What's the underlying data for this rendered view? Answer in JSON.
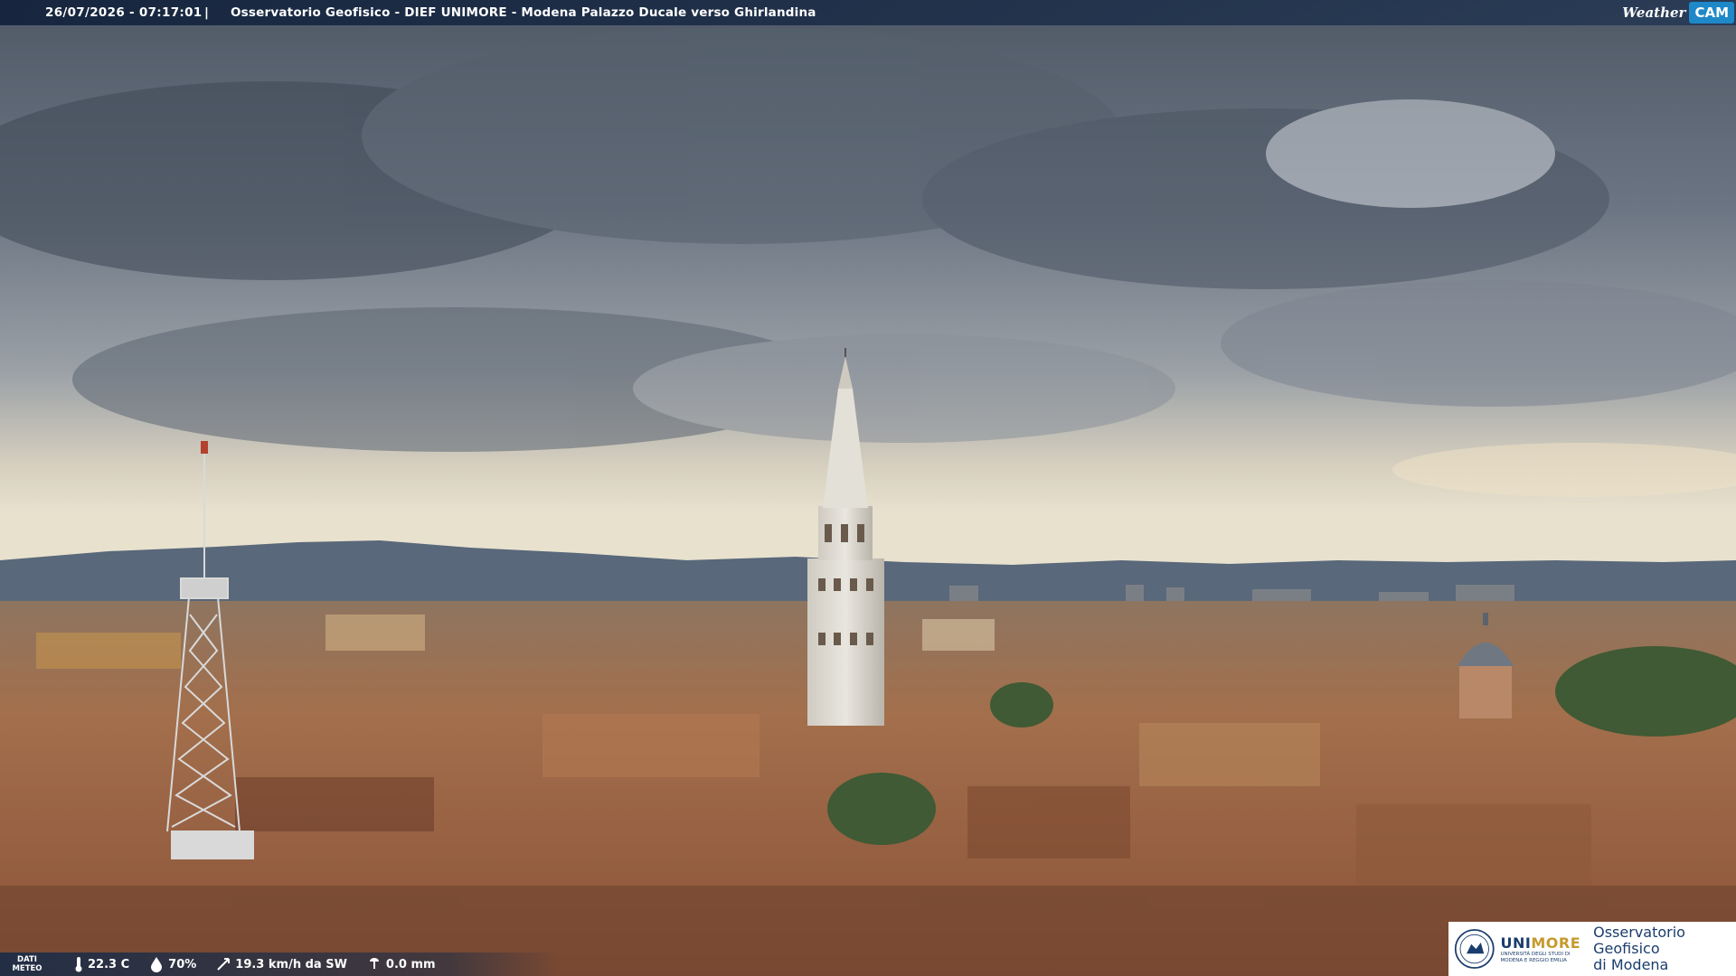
{
  "overlay": {
    "timestamp": "26/07/2026 - 07:17:01",
    "separator": "|",
    "title": "Osservatorio Geofisico - DIEF UNIMORE - Modena Palazzo Ducale verso Ghirlandina",
    "brand_weather": "Weather",
    "brand_cam": "CAM"
  },
  "meteo": {
    "label_line1": "DATI",
    "label_line2": "METEO",
    "temperature": "22.3 C",
    "humidity": "70%",
    "wind": "19.3 km/h da SW",
    "rain": "0.0 mm",
    "icons": [
      "thermometer-icon",
      "humidity-drop-icon",
      "wind-icon",
      "rain-gauge-icon"
    ]
  },
  "logo": {
    "university_name_a": "UNI",
    "university_name_b": "MORE",
    "university_sub1": "UNIVERSITÀ DEGLI STUDI DI",
    "university_sub2": "MODENA E REGGIO EMILIA",
    "observatory_line1": "Osservatorio Geofisico",
    "observatory_line2": "di Modena"
  },
  "colors": {
    "sky_top": "#56606e",
    "sky_horizon": "#e6dfcc",
    "roofs": "#a86a44",
    "brand_blue": "#1e88c9",
    "unimore_blue": "#1b3d6d",
    "unimore_gold": "#c69a2e"
  }
}
